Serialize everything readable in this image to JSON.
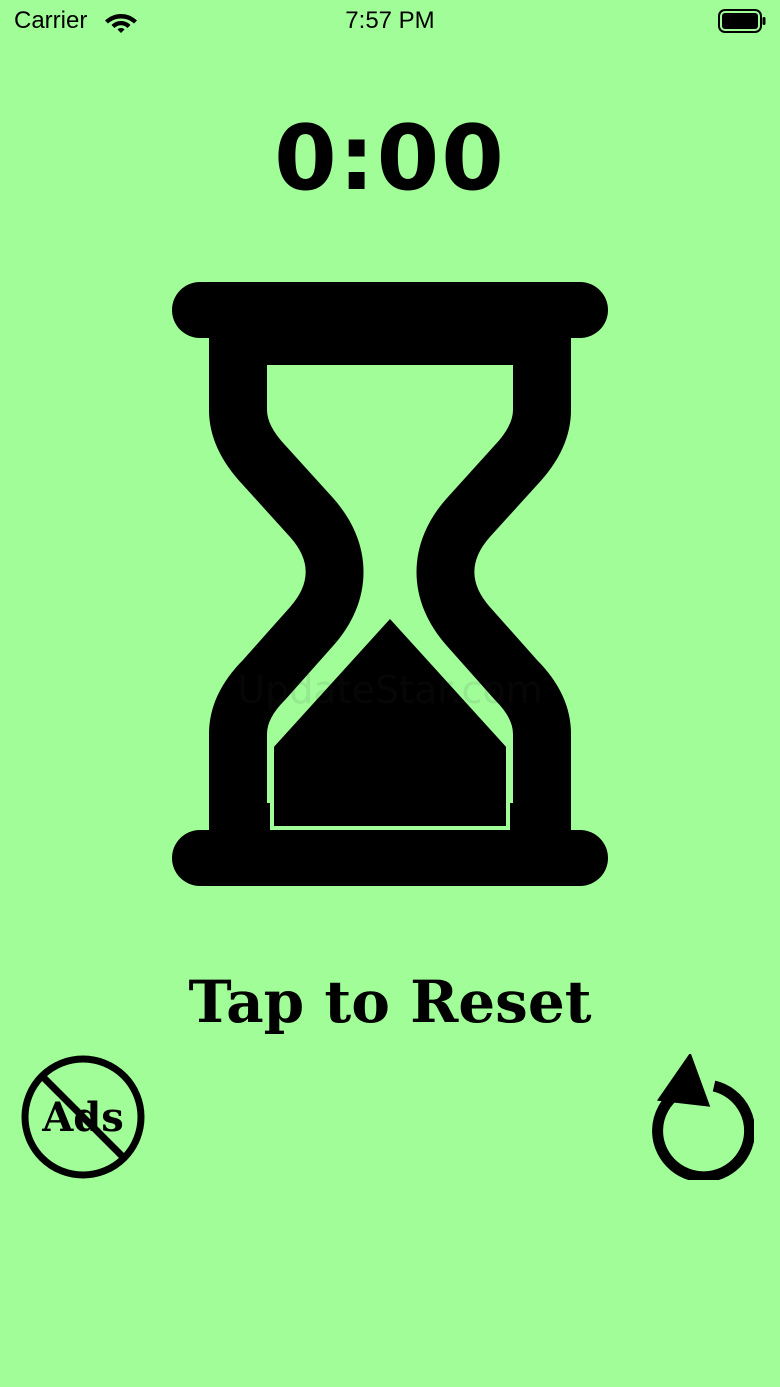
{
  "status_bar": {
    "carrier": "Carrier",
    "time": "7:57 PM"
  },
  "timer": {
    "display": "0:00"
  },
  "reset_prompt": "Tap to Reset",
  "no_ads": {
    "label": "Ads",
    "icon": "no-ads-icon"
  },
  "reset_button": {
    "icon": "reset-arrow-icon"
  },
  "hourglass": {
    "icon": "hourglass-icon",
    "sand_top_fraction": 0,
    "sand_bottom_fraction": 1
  },
  "watermark": "UpdateStar.com",
  "colors": {
    "background": "#a0fd98",
    "foreground": "#000000"
  }
}
